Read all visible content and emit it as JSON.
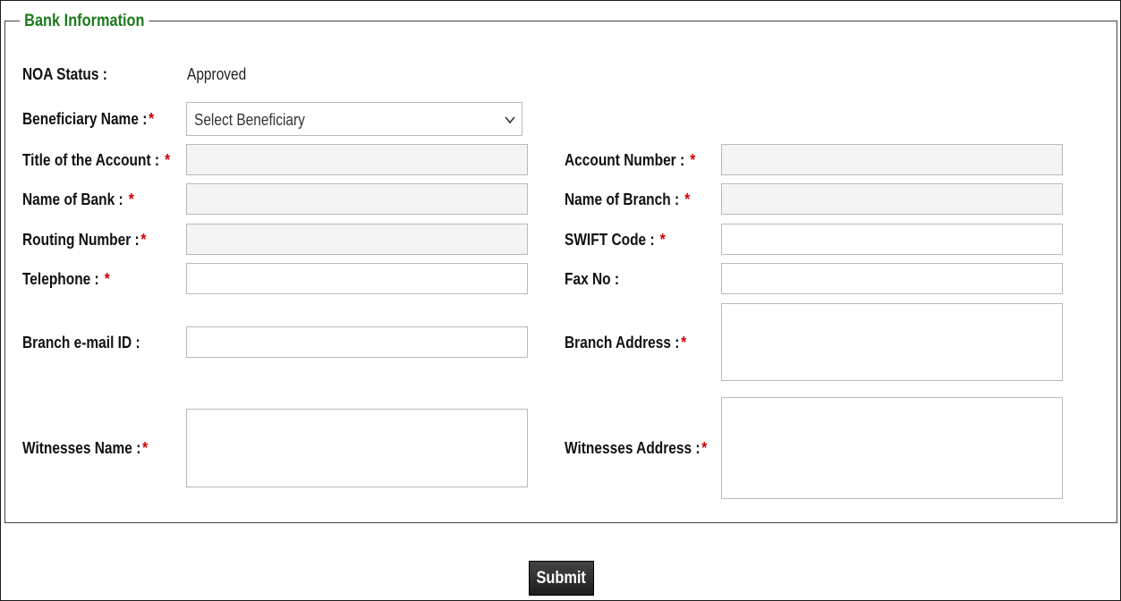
{
  "section": {
    "legend": "Bank Information"
  },
  "noa": {
    "label": "NOA Status :",
    "value": "Approved"
  },
  "beneficiary": {
    "label": "Beneficiary Name :",
    "selected": "Select Beneficiary"
  },
  "fields": {
    "title_account": {
      "label": "Title of the Account : ",
      "value": ""
    },
    "account_number": {
      "label": "Account Number : ",
      "value": ""
    },
    "bank_name": {
      "label": "Name of Bank : ",
      "value": ""
    },
    "branch_name": {
      "label": "Name of Branch : ",
      "value": ""
    },
    "routing_number": {
      "label": "Routing Number :",
      "value": ""
    },
    "swift_code": {
      "label": "SWIFT Code : ",
      "value": ""
    },
    "telephone": {
      "label": "Telephone : ",
      "value": ""
    },
    "fax": {
      "label": "Fax No :",
      "value": ""
    },
    "branch_email": {
      "label": "Branch e-mail ID :",
      "value": ""
    },
    "branch_address": {
      "label": "Branch Address :",
      "value": ""
    },
    "witness_name": {
      "label": "Witnesses Name :",
      "value": ""
    },
    "witness_address": {
      "label": "Witnesses Address :",
      "value": ""
    }
  },
  "required_mark": "*",
  "submit_label": "Submit",
  "colors": {
    "legend": "#1c7a1c",
    "required": "#d00000",
    "button": "#2a2a2a"
  }
}
